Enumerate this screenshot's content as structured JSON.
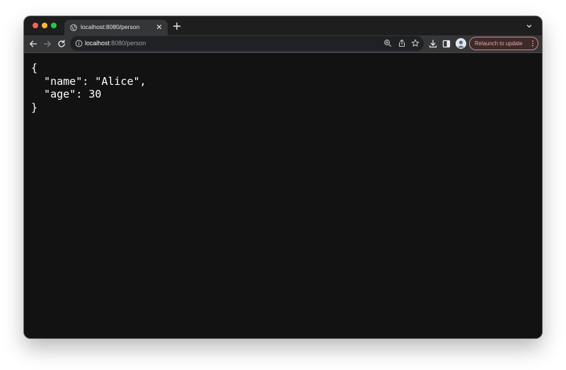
{
  "window": {
    "traffic_lights": [
      "close",
      "minimize",
      "zoom"
    ]
  },
  "tab": {
    "title": "localhost:8080/person",
    "favicon": "globe-icon"
  },
  "toolbar": {
    "url_host": "localhost",
    "url_rest": ":8080/person",
    "relaunch_label": "Relaunch to update",
    "icons": [
      "back-arrow-icon",
      "forward-arrow-icon",
      "reload-icon",
      "info-icon",
      "zoom-icon",
      "share-icon",
      "bookmark-star-icon",
      "download-icon",
      "side-panel-icon",
      "avatar",
      "more-vert-icon"
    ]
  },
  "content": {
    "lines": [
      "{",
      "  \"name\": \"Alice\",",
      "  \"age\": 30",
      "}"
    ]
  },
  "colors": {
    "page_background": "#121212",
    "toolbar": "#353638",
    "tabstrip": "#1e1e1f",
    "relaunch_accent": "#f0a49e"
  }
}
